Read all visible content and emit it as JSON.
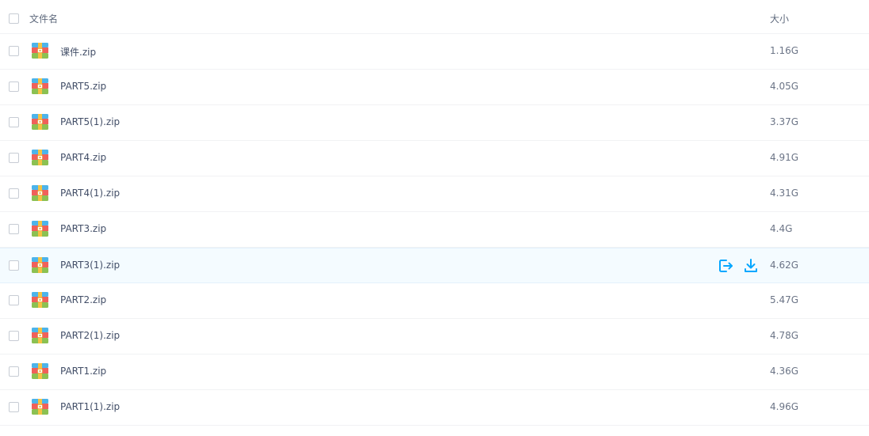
{
  "header": {
    "name_label": "文件名",
    "size_label": "大小"
  },
  "files": [
    {
      "name": "课件.zip",
      "size": "1.16G"
    },
    {
      "name": "PART5.zip",
      "size": "4.05G"
    },
    {
      "name": "PART5(1).zip",
      "size": "3.37G"
    },
    {
      "name": "PART4.zip",
      "size": "4.91G"
    },
    {
      "name": "PART4(1).zip",
      "size": "4.31G"
    },
    {
      "name": "PART3.zip",
      "size": "4.4G"
    },
    {
      "name": "PART3(1).zip",
      "size": "4.62G"
    },
    {
      "name": "PART2.zip",
      "size": "5.47G"
    },
    {
      "name": "PART2(1).zip",
      "size": "4.78G"
    },
    {
      "name": "PART1.zip",
      "size": "4.36G"
    },
    {
      "name": "PART1(1).zip",
      "size": "4.96G"
    }
  ],
  "hovered_row_index": 6,
  "row_actions": {
    "share_icon": "share-export-icon",
    "download_icon": "download-icon"
  },
  "file_icon": "zip-archive-icon",
  "colors": {
    "accent": "#06a7ff",
    "hover_row_bg": "#f4fbff",
    "text": "#424e67",
    "divider": "#f1f2f4"
  }
}
